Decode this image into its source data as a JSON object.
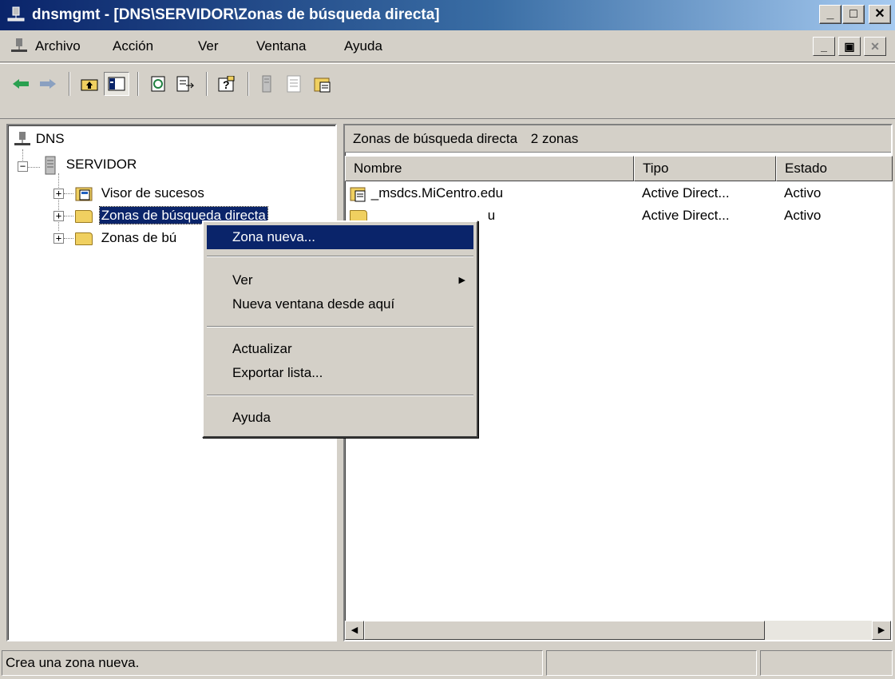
{
  "window": {
    "title": "dnsmgmt - [DNS\\SERVIDOR\\Zonas de búsqueda directa]"
  },
  "menubar": {
    "items": [
      {
        "label": "Archivo"
      },
      {
        "label": "Acción"
      },
      {
        "label": "Ver"
      },
      {
        "label": "Ventana"
      },
      {
        "label": "Ayuda"
      }
    ]
  },
  "toolbar": {
    "buttons": [
      "back-icon",
      "forward-icon",
      "up-folder-icon",
      "show-tree-icon",
      "refresh-icon",
      "export-list-icon",
      "help-icon",
      "server-icon",
      "properties-icon",
      "zone-icon"
    ]
  },
  "tree": {
    "root": "DNS",
    "server": "SERVIDOR",
    "children": [
      "Visor de sucesos",
      "Zonas de búsqueda directa",
      "Zonas de bú"
    ]
  },
  "rightpane": {
    "header_title": "Zonas de búsqueda directa",
    "header_count": "2 zonas",
    "columns": [
      "Nombre",
      "Tipo",
      "Estado"
    ],
    "rows": [
      {
        "nombre": "_msdcs.MiCentro.edu",
        "tipo": "Active Direct...",
        "estado": "Activo"
      },
      {
        "nombre": "u",
        "tipo": "Active Direct...",
        "estado": "Activo"
      }
    ]
  },
  "context_menu": {
    "items": [
      "Zona nueva...",
      "Ver",
      "Nueva ventana desde aquí",
      "Actualizar",
      "Exportar lista...",
      "Ayuda"
    ]
  },
  "statusbar": {
    "text": "Crea una zona nueva."
  },
  "colors": {
    "titlebar": "#0a246a",
    "selection": "#0a246a",
    "face": "#d4d0c8"
  }
}
